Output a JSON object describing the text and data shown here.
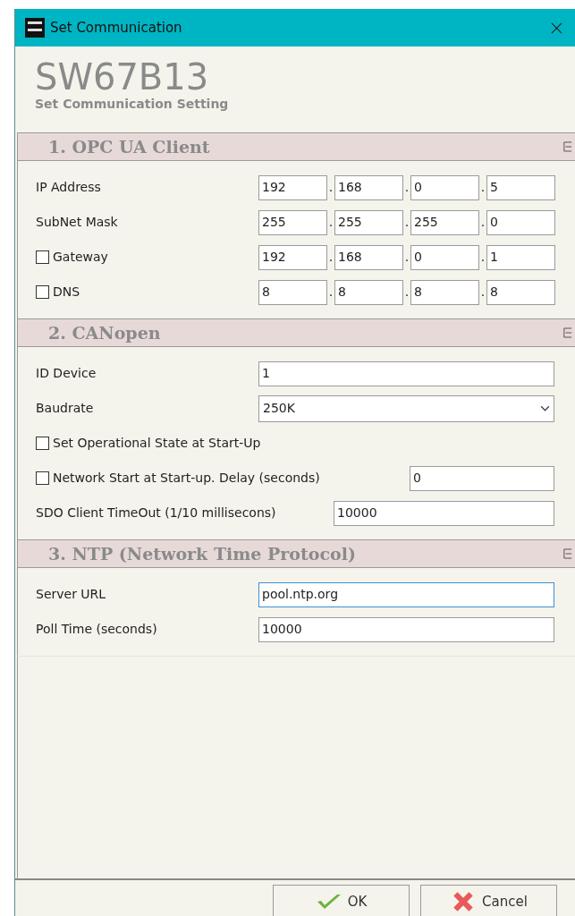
{
  "window": {
    "title": "Set Communication"
  },
  "header": {
    "title": "SW67B13",
    "subtitle": "Set Communication Setting"
  },
  "sections": [
    {
      "title": "1. OPC UA Client",
      "rows": [
        {
          "kind": "ip",
          "label": "IP Address",
          "octets": [
            "192",
            "168",
            "0",
            "5"
          ],
          "separators": [
            ".",
            ".",
            "."
          ]
        },
        {
          "kind": "ip",
          "label": "SubNet Mask",
          "octets": [
            "255",
            "255",
            "255",
            "0"
          ],
          "separators": [
            ".",
            ".",
            "."
          ]
        },
        {
          "kind": "ip",
          "label": "Gateway",
          "checked": false,
          "octets": [
            "192",
            "168",
            "0",
            "1"
          ],
          "separators": [
            ".",
            ".",
            "."
          ]
        },
        {
          "kind": "ip",
          "label": "DNS",
          "checked": false,
          "octets": [
            "8",
            "8",
            "8",
            "8"
          ],
          "separators": [
            ".",
            ".",
            "."
          ]
        }
      ]
    },
    {
      "title": "2. CANopen",
      "rows": [
        {
          "kind": "field",
          "label": "ID Device",
          "value": "1"
        },
        {
          "kind": "select",
          "label": "Baudrate",
          "value": "250K"
        },
        {
          "kind": "option",
          "label": "Set Operational State at Start-Up",
          "checked": false
        },
        {
          "kind": "delayed_field",
          "label": "Network Start at Start-up. Delay (seconds)",
          "checked": false,
          "value": "0"
        },
        {
          "kind": "long_field",
          "label": "SDO Client TimeOut (1/10 millisecons)",
          "value": "10000"
        }
      ]
    },
    {
      "title": "3. NTP (Network Time Protocol)",
      "rows": [
        {
          "kind": "field",
          "label": "Server URL",
          "value": "pool.ntp.org",
          "focused": true
        },
        {
          "kind": "field",
          "label": "Poll Time (seconds)",
          "value": "10000",
          "focused": false
        }
      ]
    }
  ],
  "buttons": [
    {
      "kind": "ok",
      "label": "OK"
    },
    {
      "kind": "cancel",
      "label": "Cancel"
    }
  ]
}
